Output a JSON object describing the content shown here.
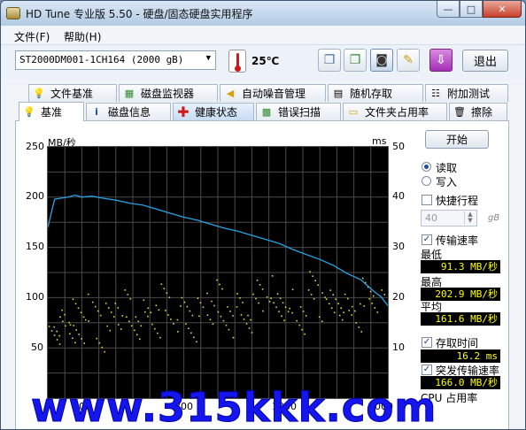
{
  "window": {
    "title": "HD Tune 专业版 5.50 - 硬盘/固态硬盘实用程序",
    "minimize": "—",
    "maximize": "□",
    "close": "✕"
  },
  "menu": {
    "file": "文件(F)",
    "help": "帮助(H)"
  },
  "toolbar": {
    "drive": "ST2000DM001-1CH164 (2000 gB)",
    "temperature": "25℃",
    "exit_label": "退出"
  },
  "tabs_top": [
    "文件基准",
    "磁盘监视器",
    "自动噪音管理",
    "随机存取",
    "附加测试"
  ],
  "tabs_bottom": [
    "基准",
    "磁盘信息",
    "健康状态",
    "错误扫描",
    "文件夹占用率",
    "擦除"
  ],
  "selected_tab": "基准",
  "chart_data": {
    "type": "line",
    "y_left_label": "MB/秒",
    "y_right_label": "ms",
    "y_left_ticks": [
      "250",
      "200",
      "150",
      "100",
      "50"
    ],
    "y_right_ticks": [
      "50",
      "40",
      "30",
      "20",
      "10"
    ],
    "y_left_range": [
      0,
      250
    ],
    "y_right_range": [
      0,
      50
    ],
    "x_ticks_visible": [
      "200",
      "800",
      "1200",
      "2000"
    ],
    "x_range": [
      0,
      2000
    ],
    "x_unit": "gB",
    "grid": true,
    "series": [
      {
        "color": "#29a3e6",
        "x": [
          0,
          40,
          80,
          120,
          160,
          200,
          260,
          320,
          400,
          480,
          560,
          640,
          720,
          800,
          880,
          960,
          1040,
          1120,
          1200,
          1280,
          1360,
          1440,
          1520,
          1600,
          1680,
          1760,
          1840,
          1920,
          1960,
          2000
        ],
        "y": [
          170,
          198,
          199,
          200,
          202,
          200,
          201,
          199,
          197,
          194,
          192,
          188,
          184,
          180,
          177,
          173,
          169,
          166,
          162,
          158,
          154,
          148,
          143,
          138,
          132,
          124,
          118,
          106,
          101,
          92
        ]
      },
      {
        "color": "#d8d840",
        "scatter": true,
        "x": [
          30,
          80,
          120,
          160,
          200,
          260,
          320,
          380,
          440,
          500,
          560,
          620,
          680,
          740,
          800,
          860,
          920,
          980,
          1040,
          1100,
          1160,
          1220,
          1280,
          1340,
          1400,
          1460,
          1520,
          1580,
          1640,
          1700,
          1760,
          1820,
          1880,
          1940
        ],
        "y": [
          13,
          15,
          14,
          17,
          13,
          18,
          12,
          16,
          19,
          14,
          17,
          15,
          20,
          16,
          18,
          14,
          17,
          21,
          15,
          19,
          16,
          18,
          22,
          17,
          20,
          15,
          19,
          23,
          17,
          20,
          18,
          16,
          21,
          19
        ]
      }
    ]
  },
  "controls": {
    "start_label": "开始",
    "read_label": "读取",
    "write_label": "写入",
    "quick_label": "快捷行程",
    "quick_value": "40",
    "quick_unit": "gB",
    "transfer_label": "传输速率",
    "min_label": "最低",
    "min_value": "91.3 MB/秒",
    "max_label": "最高",
    "max_value": "202.9 MB/秒",
    "avg_label": "平均",
    "avg_value": "161.6 MB/秒",
    "access_label": "存取时间",
    "access_value": "16.2 ms",
    "burst_label": "突发传输速率",
    "burst_value": "166.0 MB/秒",
    "cpu_label": "CPU 占用率"
  },
  "watermark": "www.315kkk.com"
}
